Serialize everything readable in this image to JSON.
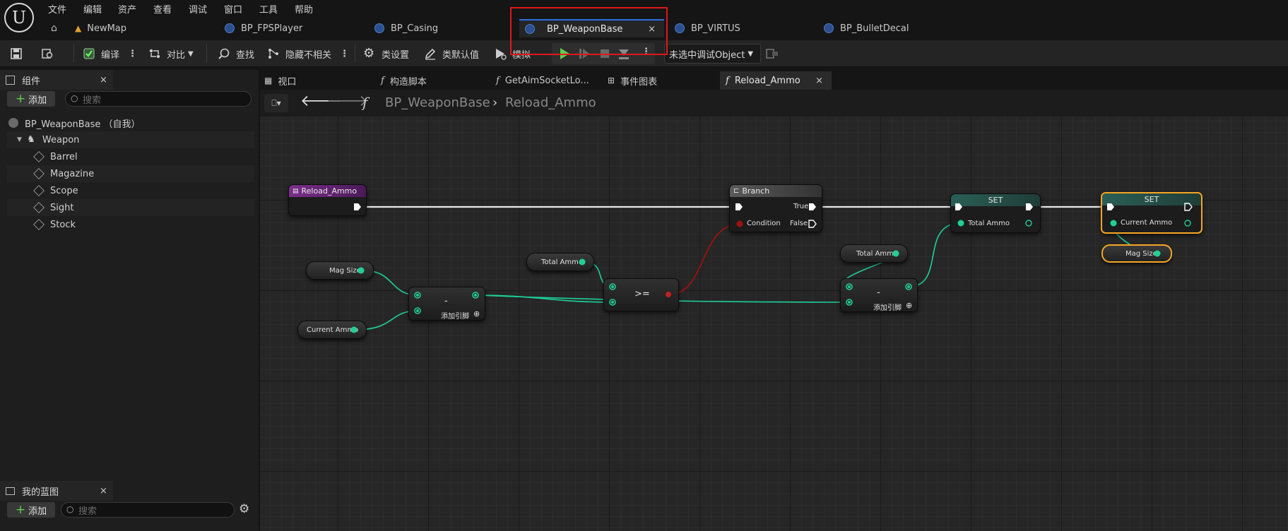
{
  "menu": [
    "文件",
    "编辑",
    "资产",
    "查看",
    "调试",
    "窗口",
    "工具",
    "帮助"
  ],
  "doc_tabs": {
    "newmap": "NewMap",
    "fpsplayer": "BP_FPSPlayer",
    "casing": "BP_Casing",
    "weaponbase": "BP_WeaponBase",
    "virtus": "BP_VIRTUS",
    "bulletdecal": "BP_BulletDecal"
  },
  "toolbar": {
    "compile": "编译",
    "diff": "对比",
    "find": "查找",
    "hide_unrelated": "隐藏不相关",
    "class_settings": "类设置",
    "class_defaults": "类默认值",
    "simulate": "模拟",
    "debug_object": "未选中调试Object"
  },
  "components_panel": {
    "title": "组件",
    "add": "添加",
    "search_placeholder": "搜索",
    "root": "BP_WeaponBase （自我）",
    "items": [
      "Weapon",
      "Barrel",
      "Magazine",
      "Scope",
      "Sight",
      "Stock"
    ]
  },
  "my_blueprint_panel": {
    "title": "我的蓝图",
    "add": "添加",
    "search_placeholder": "搜索"
  },
  "graph_tabs": [
    "视口",
    "构造脚本",
    "GetAimSocketLo...",
    "事件图表",
    "Reload_Ammo"
  ],
  "breadcrumb": {
    "root": "BP_WeaponBase",
    "current": "Reload_Ammo"
  },
  "nodes": {
    "entry": "Reload_Ammo",
    "branch": "Branch",
    "branch_true": "True",
    "branch_false": "False",
    "branch_condition": "Condition",
    "set1": "SET",
    "set1_pin": "Total Ammo",
    "set2": "SET",
    "set2_pin": "Current Ammo",
    "mag_size_1": "Mag Size",
    "current_ammo": "Current Ammo",
    "total_ammo_1": "Total Ammo",
    "total_ammo_2": "Total Ammo",
    "mag_size_2": "Mag Size",
    "subtract_1": "-",
    "subtract_1_add_pin": "添加引脚",
    "compare": ">=",
    "subtract_2": "-",
    "subtract_2_add_pin": "添加引脚"
  },
  "colors": {
    "highlight_box": "#e01818",
    "selection": "#f5a623",
    "int_pin": "#1fcf98",
    "bool_pin": "#9c1212",
    "function_header": "#6a2a78",
    "play_green": "#5fd04a"
  }
}
